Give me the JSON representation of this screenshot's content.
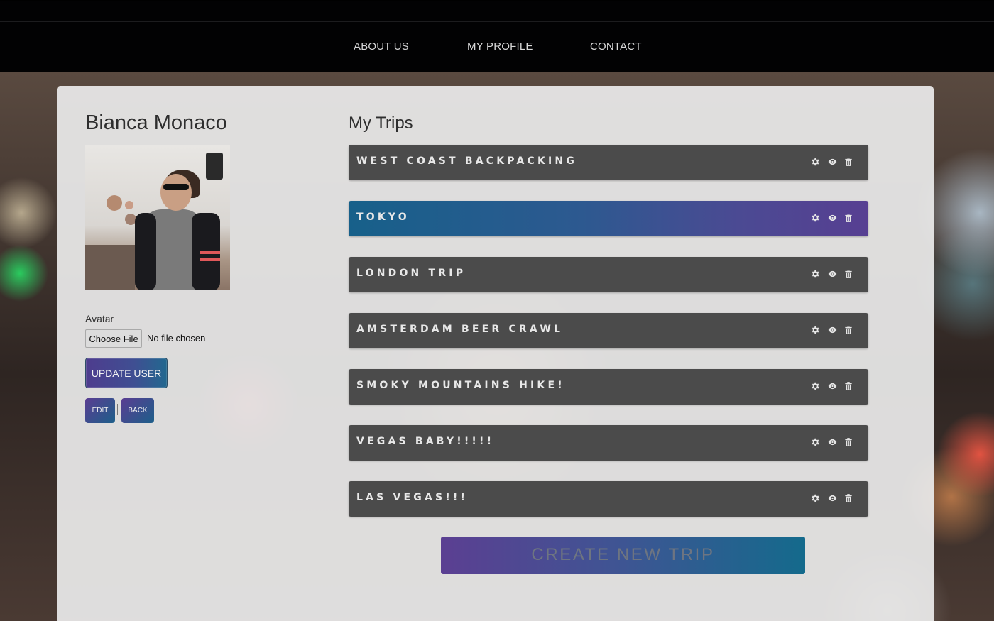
{
  "nav": {
    "about": "ABOUT US",
    "profile": "MY PROFILE",
    "contact": "CONTACT"
  },
  "user": {
    "name": "Bianca Monaco",
    "avatar_label": "Avatar",
    "choose_file": "Choose File",
    "no_file": "No file chosen",
    "update_label": "UPDATE USER",
    "edit_label": "EDIT",
    "back_label": "BACK"
  },
  "trips": {
    "heading": "My Trips",
    "items": [
      {
        "title": "WEST COAST BACKPACKING",
        "active": false
      },
      {
        "title": "TOKYO",
        "active": true
      },
      {
        "title": "LONDON TRIP",
        "active": false
      },
      {
        "title": "AMSTERDAM BEER CRAWL",
        "active": false
      },
      {
        "title": "SMOKY MOUNTAINS HIKE!",
        "active": false
      },
      {
        "title": "VEGAS BABY!!!!!",
        "active": false
      },
      {
        "title": "LAS VEGAS!!!",
        "active": false
      }
    ],
    "icons": [
      "gear-icon",
      "eye-icon",
      "trash-icon"
    ],
    "create_label": "CREATE NEW TRIP"
  },
  "colors": {
    "topbar": "#020203",
    "trip_bar": "#4b4b4b",
    "accent_purple": "#573f92",
    "accent_blue": "#17608a"
  }
}
